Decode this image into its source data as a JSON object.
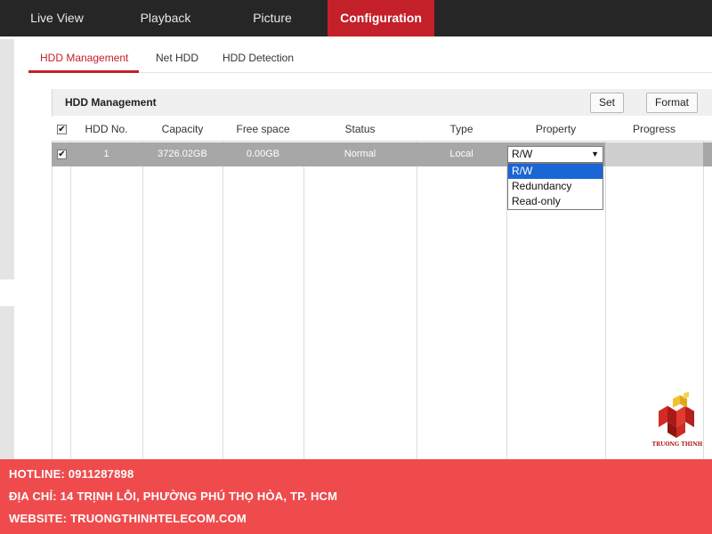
{
  "nav": {
    "items": [
      {
        "label": "Live View"
      },
      {
        "label": "Playback"
      },
      {
        "label": "Picture"
      },
      {
        "label": "Configuration"
      }
    ],
    "active_index": 3
  },
  "subtabs": {
    "items": [
      {
        "label": "HDD Management"
      },
      {
        "label": "Net HDD"
      },
      {
        "label": "HDD Detection"
      }
    ],
    "active_index": 0
  },
  "panel": {
    "title": "HDD Management",
    "set_label": "Set",
    "format_label": "Format"
  },
  "table": {
    "headers": [
      "HDD No.",
      "Capacity",
      "Free space",
      "Status",
      "Type",
      "Property",
      "Progress"
    ],
    "rows": [
      {
        "checked": true,
        "hdd_no": "1",
        "capacity": "3726.02GB",
        "free_space": "0.00GB",
        "status": "Normal",
        "type": "Local",
        "property": "R/W",
        "progress": ""
      }
    ],
    "select_all_checked": true
  },
  "property_dropdown": {
    "value": "R/W",
    "options": [
      "R/W",
      "Redundancy",
      "Read-only"
    ],
    "highlighted_index": 0
  },
  "logo": {
    "text": "TRUONG THINH"
  },
  "footer": {
    "hotline": "HOTLINE: 0911287898",
    "address": "ĐỊA CHỈ: 14 TRỊNH LỖI, PHƯỜNG PHÚ THỌ HÒA, TP. HCM",
    "website": "WEBSITE: TRUONGTHINHTELECOM.COM"
  },
  "colors": {
    "nav_bg": "#262626",
    "accent_red": "#c4202a",
    "row_selected_bg": "#a7a7a7",
    "dropdown_highlight": "#1a66d4",
    "footer_bg": "#ef4b4d"
  }
}
